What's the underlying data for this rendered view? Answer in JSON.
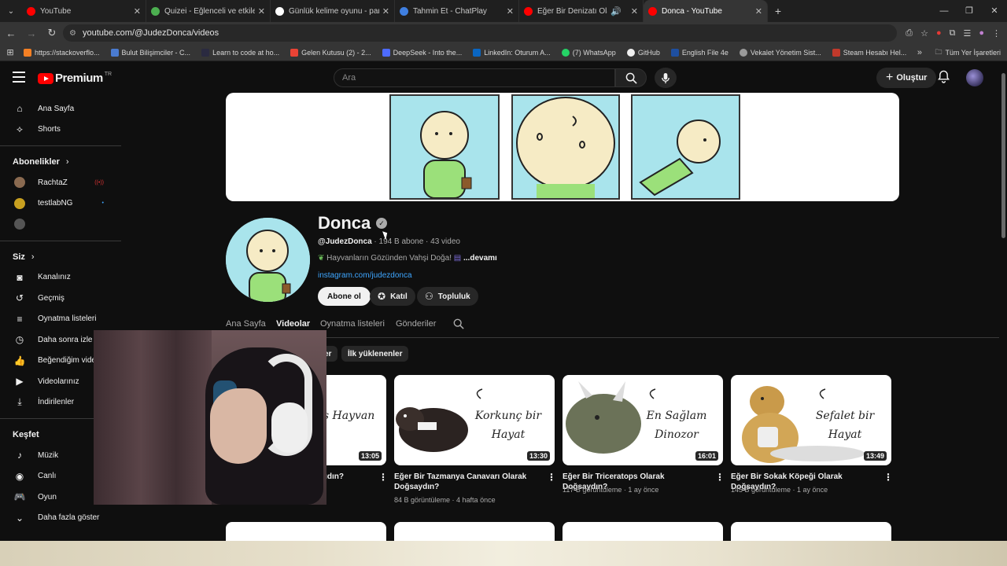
{
  "browser": {
    "tabs": [
      {
        "title": "YouTube",
        "color": "#ff0000"
      },
      {
        "title": "Quizei - Eğlenceli ve etkileşimli",
        "color": "#4caf50"
      },
      {
        "title": "Günlük kelime oyunu - parolla",
        "color": "#ffffff"
      },
      {
        "title": "Tahmin Et - ChatPlay",
        "color": "#3f7fe0"
      },
      {
        "title": "Eğer Bir Denizatı Olarak Do",
        "color": "#ff0000"
      },
      {
        "title": "Donca - YouTube",
        "color": "#ff0000"
      }
    ],
    "url": "youtube.com/@JudezDonca/videos",
    "bookmarks": [
      {
        "label": "https://stackoverflo...",
        "color": "#f48024"
      },
      {
        "label": "Bulut Bilişimciler - C...",
        "color": "#4a7bd0"
      },
      {
        "label": "Learn to code at ho...",
        "color": "#2a2a40"
      },
      {
        "label": "Gelen Kutusu (2) - 2...",
        "color": "#ea4335"
      },
      {
        "label": "DeepSeek - Into the...",
        "color": "#4d6bfe"
      },
      {
        "label": "LinkedIn: Oturum A...",
        "color": "#0a66c2"
      },
      {
        "label": "(7) WhatsApp",
        "color": "#25d366"
      },
      {
        "label": "GitHub",
        "color": "#f0f0f0"
      },
      {
        "label": "English File 4e",
        "color": "#1e4fa0"
      },
      {
        "label": "Vekalet Yönetim Sist...",
        "color": "#9a9a9a"
      },
      {
        "label": "Steam Hesabı Hel...",
        "color": "#c0392b"
      }
    ],
    "all_bookmarks": "Tüm Yer İşaretleri"
  },
  "header": {
    "logo_text": "Premium",
    "region": "TR",
    "search_placeholder": "Ara",
    "create_label": "Oluştur"
  },
  "sidebar": {
    "main": [
      {
        "label": "Ana Sayfa",
        "icon": "home-icon"
      },
      {
        "label": "Shorts",
        "icon": "shorts-icon"
      }
    ],
    "subscriptions_title": "Abonelikler",
    "subscriptions": [
      {
        "label": "RachtaZ",
        "color": "#8a6a50"
      },
      {
        "label": "testlabNG",
        "color": "#c8a020"
      }
    ],
    "you_title": "Siz",
    "you": [
      {
        "label": "Kanalınız",
        "icon": "channel-icon"
      },
      {
        "label": "Geçmiş",
        "icon": "history-icon"
      },
      {
        "label": "Oynatma listeleri",
        "icon": "playlist-icon"
      },
      {
        "label": "Daha sonra izle",
        "icon": "clock-icon"
      },
      {
        "label": "Beğendiğim videolar",
        "icon": "like-icon"
      },
      {
        "label": "Videolarınız",
        "icon": "video-icon"
      },
      {
        "label": "İndirilenler",
        "icon": "download-icon"
      }
    ],
    "explore_title": "Keşfet",
    "explore": [
      {
        "label": "Müzik",
        "icon": "music-icon"
      },
      {
        "label": "Canlı",
        "icon": "live-icon"
      },
      {
        "label": "Oyun",
        "icon": "gaming-icon"
      },
      {
        "label": "Daha fazla göster",
        "icon": "chevron-down-icon"
      }
    ]
  },
  "channel": {
    "name": "Donca",
    "handle": "@JudezDonca",
    "stats": " · 194 B abone · 43 video",
    "description": "Hayvanların Gözünden Vahşi Doğa!",
    "more": "...devamı",
    "link": "instagram.com/judezdonca",
    "subscribe": "Abone ol",
    "join": "Katıl",
    "community": "Topluluk",
    "tabs": [
      "Ana Sayfa",
      "Videolar",
      "Oynatma listeleri",
      "Gönderiler"
    ],
    "chips": [
      "er",
      "İlk yüklenenler"
    ]
  },
  "videos": [
    {
      "title": "yıdın?",
      "duration": "13:05",
      "caption": "Ters Hayvan",
      "meta": ""
    },
    {
      "title": "Eğer Bir Tazmanya Canavarı Olarak Doğsaydın?",
      "duration": "13:30",
      "caption": "Korkunç bir Hayat",
      "meta": "84 B görüntüleme · 4 hafta önce"
    },
    {
      "title": "Eğer Bir Triceratops Olarak Doğsaydın?",
      "duration": "16:01",
      "caption": "En Sağlam Dinozor",
      "meta": "117 B görüntüleme · 1 ay önce"
    },
    {
      "title": "Eğer Bir Sokak Köpeği Olarak Doğsaydın?",
      "duration": "13:49",
      "caption": "Sefalet bir Hayat",
      "meta": "145 B görüntüleme · 1 ay önce"
    }
  ]
}
